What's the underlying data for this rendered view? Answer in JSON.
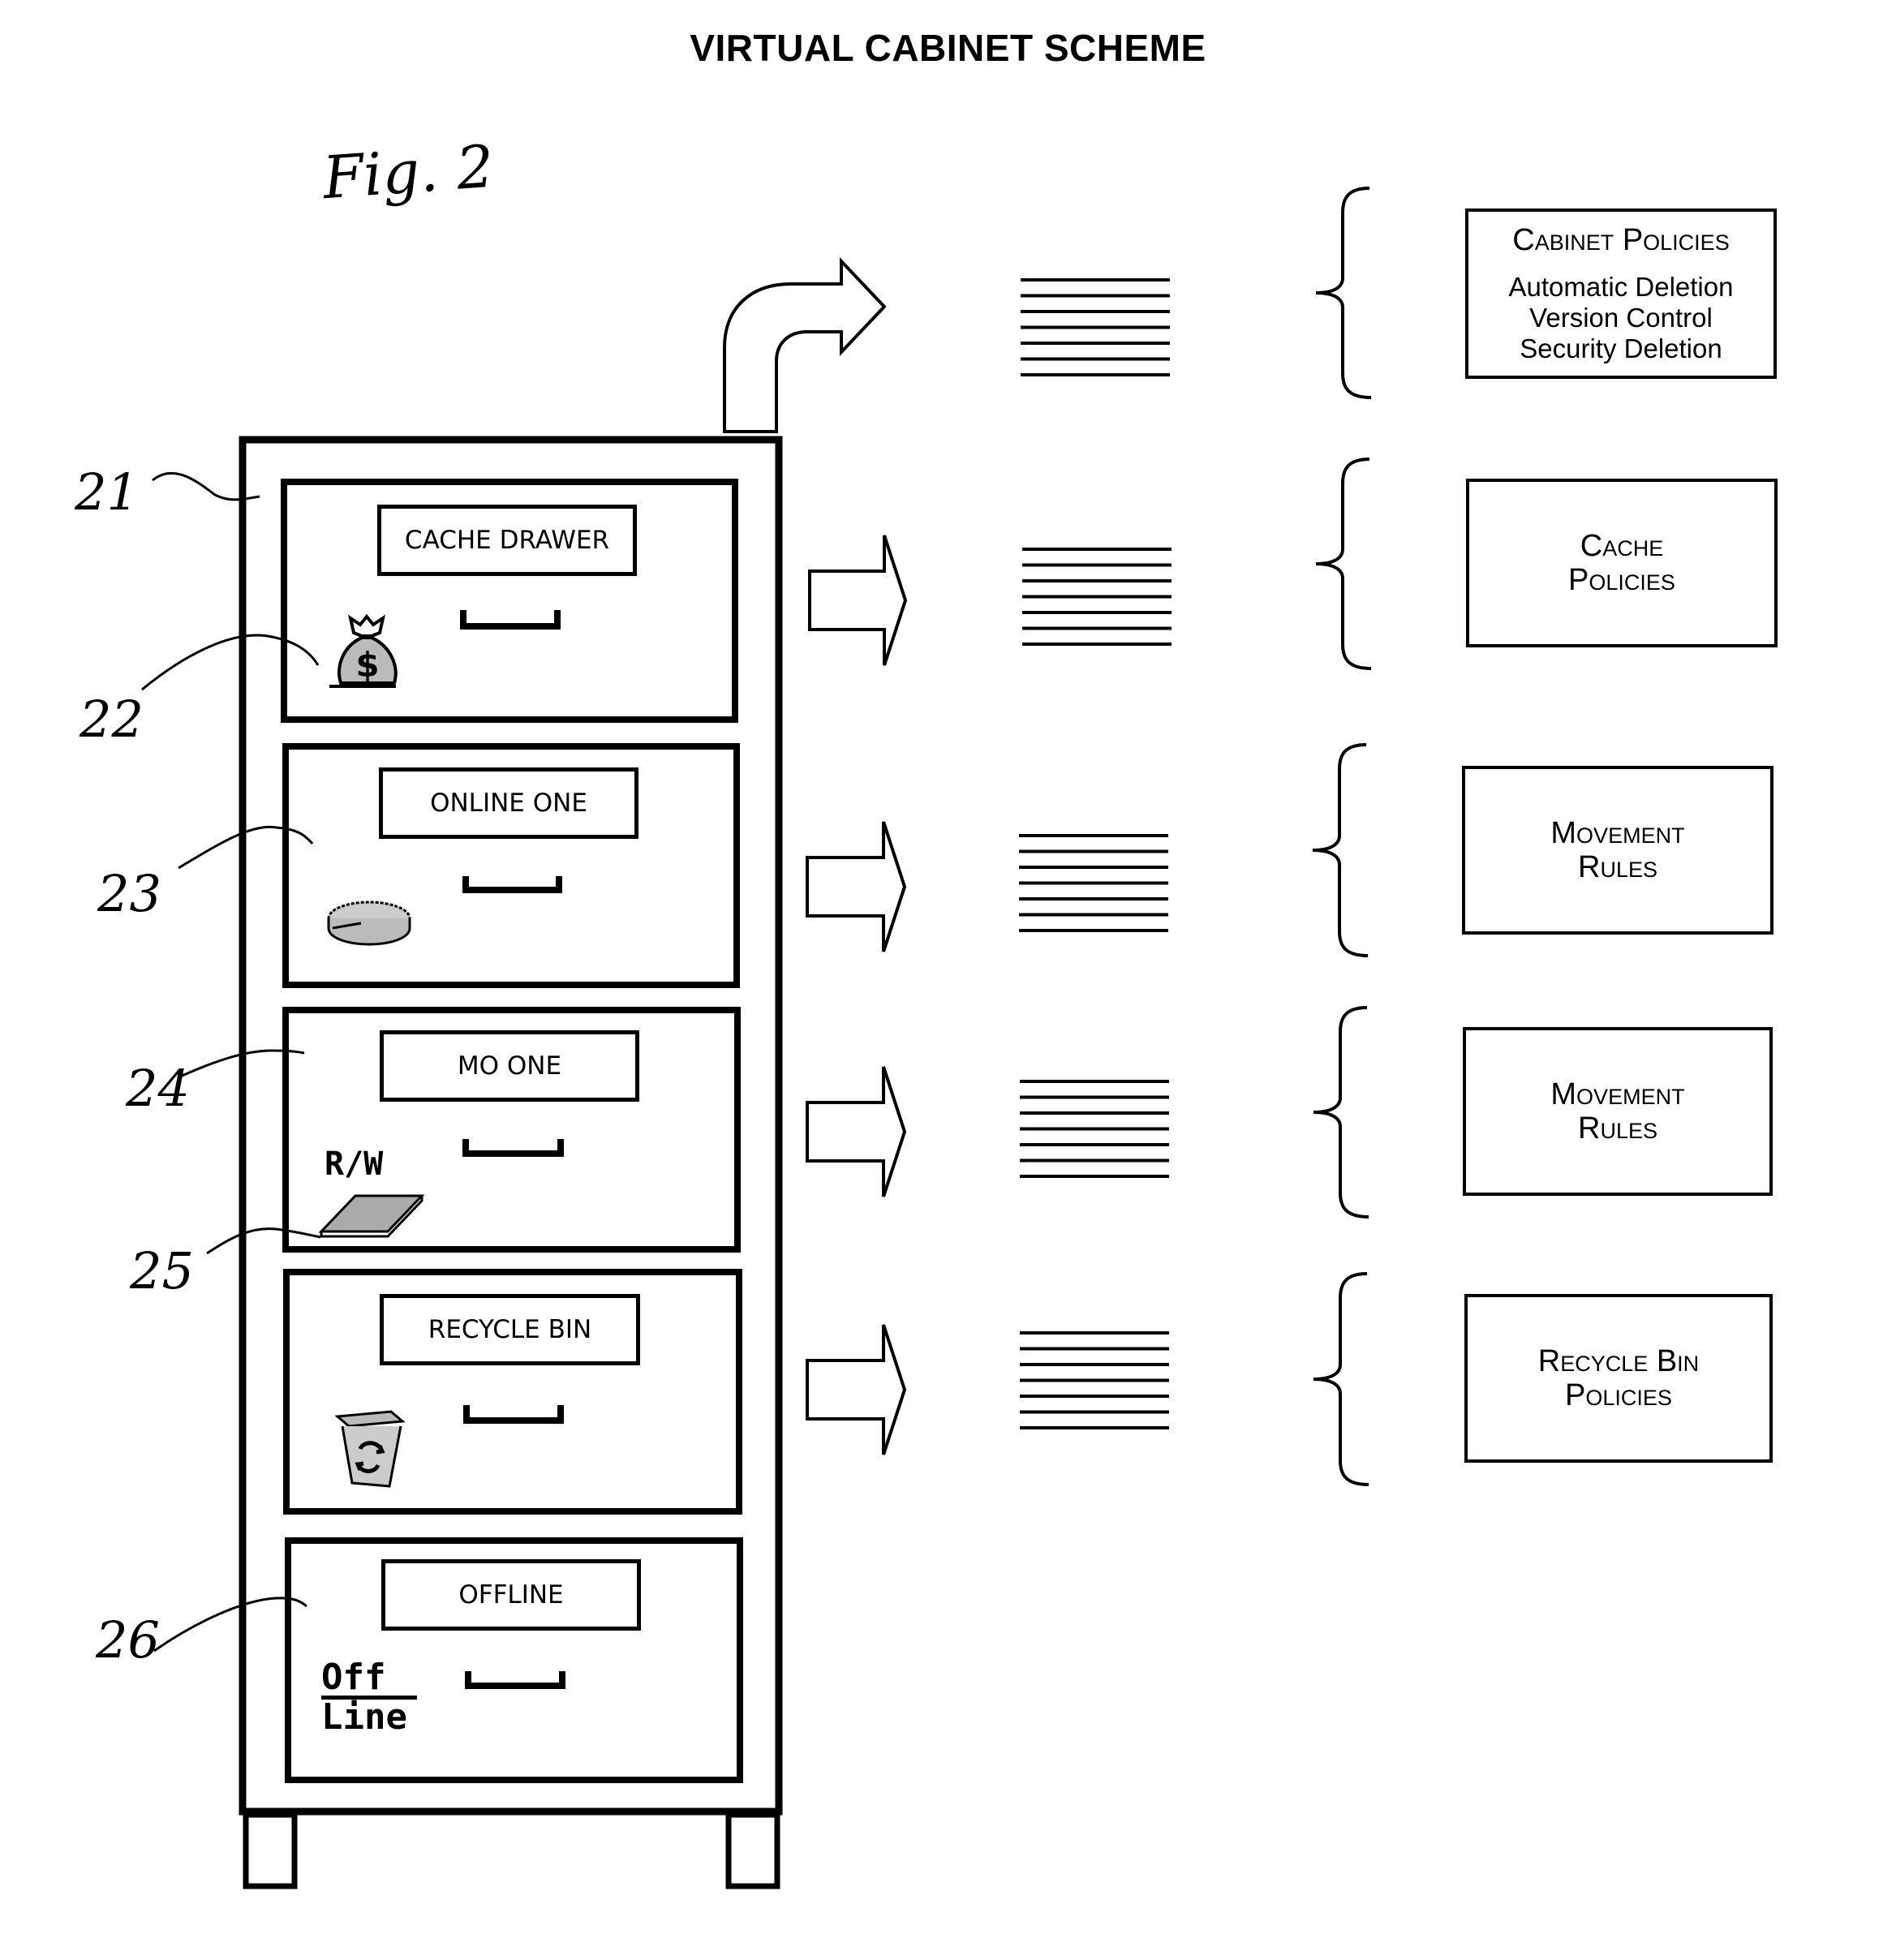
{
  "title": "VIRTUAL CABINET SCHEME",
  "figure_label": "Fig. 2",
  "cabinet": {
    "ref": "21",
    "drawers": [
      {
        "ref": "22",
        "label": "CACHE DRAWER",
        "icon": "money-bag-icon"
      },
      {
        "ref": "23",
        "label": "ONLINE ONE",
        "icon": "disk-drive-icon"
      },
      {
        "ref": "24",
        "label": "MO ONE",
        "icon": "rw-disk-icon",
        "icon_text": "R/W"
      },
      {
        "ref": "25",
        "label": "RECYCLE BIN",
        "icon": "recycle-bin-icon"
      },
      {
        "ref": "26",
        "label": "OFFLINE",
        "icon": "offline-icon",
        "icon_text_top": "Off",
        "icon_text_bottom": "Line"
      }
    ]
  },
  "policy_rows": [
    {
      "arrow": "curved-arrow",
      "lines": 7,
      "policy": {
        "title": "Cabinet Policies",
        "items": [
          "Automatic Deletion",
          "Version Control",
          "Security Deletion"
        ]
      }
    },
    {
      "arrow": "right-arrow",
      "lines": 7,
      "policy": {
        "title_line1": "Cache",
        "title_line2": "Policies"
      }
    },
    {
      "arrow": "right-arrow",
      "lines": 7,
      "policy": {
        "title_line1": "Movement",
        "title_line2": "Rules"
      }
    },
    {
      "arrow": "right-arrow",
      "lines": 7,
      "policy": {
        "title_line1": "Movement",
        "title_line2": "Rules"
      }
    },
    {
      "arrow": "right-arrow",
      "lines": 7,
      "policy": {
        "title_line1": "Recycle Bin",
        "title_line2": "Policies"
      }
    }
  ],
  "colors": {
    "ink": "#000000",
    "paper": "#ffffff",
    "halftone": "#9a9a9a"
  }
}
